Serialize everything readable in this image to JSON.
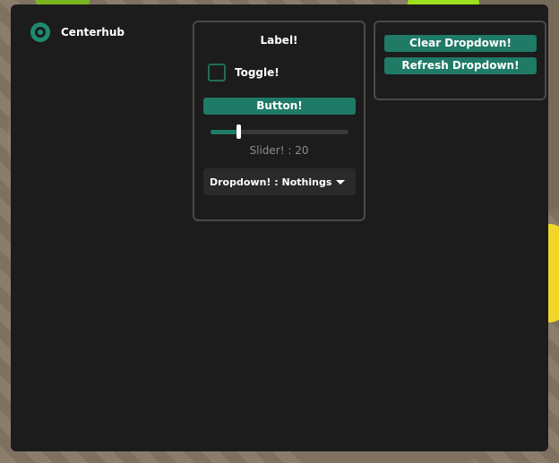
{
  "app": {
    "title": "Centerhub",
    "accent_color": "#1f7a66"
  },
  "main_panel": {
    "label": "Label!",
    "toggle": {
      "label": "Toggle!",
      "checked": false
    },
    "button_label": "Button!",
    "slider": {
      "value_text": "Slider! : 20",
      "value": 20,
      "min": 0,
      "max": 100
    },
    "dropdown": {
      "text": "Dropdown! : Nothings"
    }
  },
  "side_panel": {
    "clear_label": "Clear Dropdown!",
    "refresh_label": "Refresh Dropdown!"
  },
  "icons": {
    "brand": "target-icon",
    "dropdown": "chevron-down-icon"
  }
}
